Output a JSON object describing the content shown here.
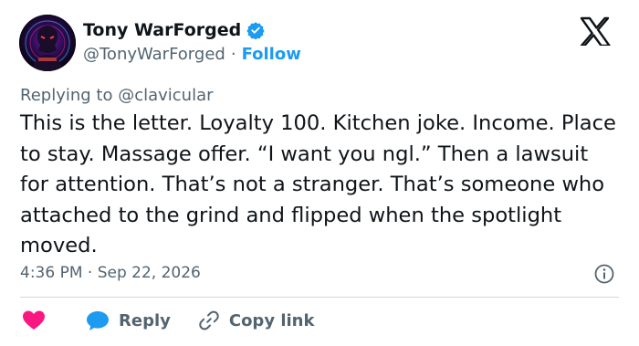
{
  "author": {
    "display_name": "Tony WarForged",
    "handle": "@TonyWarForged",
    "separator": "·",
    "follow_label": "Follow"
  },
  "reply_context": {
    "label": "Replying to @clavicular"
  },
  "tweet": {
    "text": "This is the letter. Loyalty 100. Kitchen joke. Income. Place to stay. Massage offer. “I want you ngl.” Then a lawsuit for attention. That’s not a stranger. That’s someone who attached to the grind and flipped when the spotlight moved.",
    "timestamp": "4:36 PM · Sep 22, 2026"
  },
  "actions": {
    "reply_label": "Reply",
    "copy_link_label": "Copy link"
  },
  "colors": {
    "accent": "#1d9bf0",
    "heart": "#f91880",
    "text": "#0f1419",
    "secondary": "#536471",
    "divider": "#cfd9de"
  },
  "icons": [
    "avatar-image",
    "verified-badge-icon",
    "x-logo-icon",
    "info-icon",
    "heart-icon",
    "reply-bubble-icon",
    "link-icon"
  ]
}
